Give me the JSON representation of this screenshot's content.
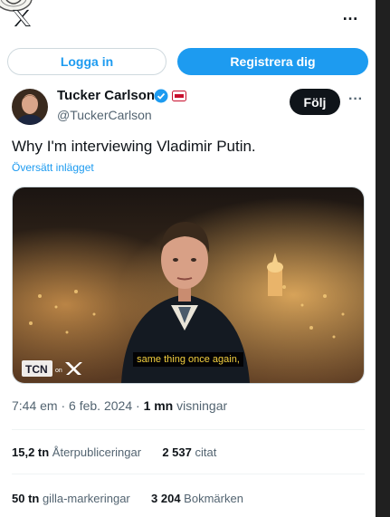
{
  "top_bar": {
    "more_glyph": "…"
  },
  "auth": {
    "login_label": "Logga in",
    "register_label": "Registrera dig"
  },
  "author": {
    "name": "Tucker Carlson",
    "handle": "@TuckerCarlson"
  },
  "follow_label": "Följ",
  "more_glyph": "···",
  "tweet": {
    "text": "Why I'm interviewing Vladimir Putin.",
    "translate_label": "Översätt inlägget",
    "caption": "same thing once again,",
    "watermark": "TCN on X"
  },
  "meta": {
    "time": "7:44 em",
    "sep1": " · ",
    "date": "6 feb. 2024",
    "sep2": " · ",
    "views_value": "1 mn",
    "views_label": " visningar"
  },
  "stats": {
    "reposts_value": "15,2 tn",
    "reposts_label": " Återpubliceringar",
    "quotes_value": "2 537",
    "quotes_label": " citat",
    "likes_value": "50 tn",
    "likes_label": " gilla-markeringar",
    "bookmarks_value": "3 204",
    "bookmarks_label": " Bokmärken"
  },
  "colors": {
    "accent": "#1d9bf0",
    "text_primary": "#0f1419",
    "text_secondary": "#536471",
    "follow_bg": "#0f1419",
    "caption_text": "#f4d03f"
  },
  "icons": [
    "x-logo-icon",
    "verified-badge-icon",
    "affiliate-badge-icon",
    "more-icon"
  ]
}
